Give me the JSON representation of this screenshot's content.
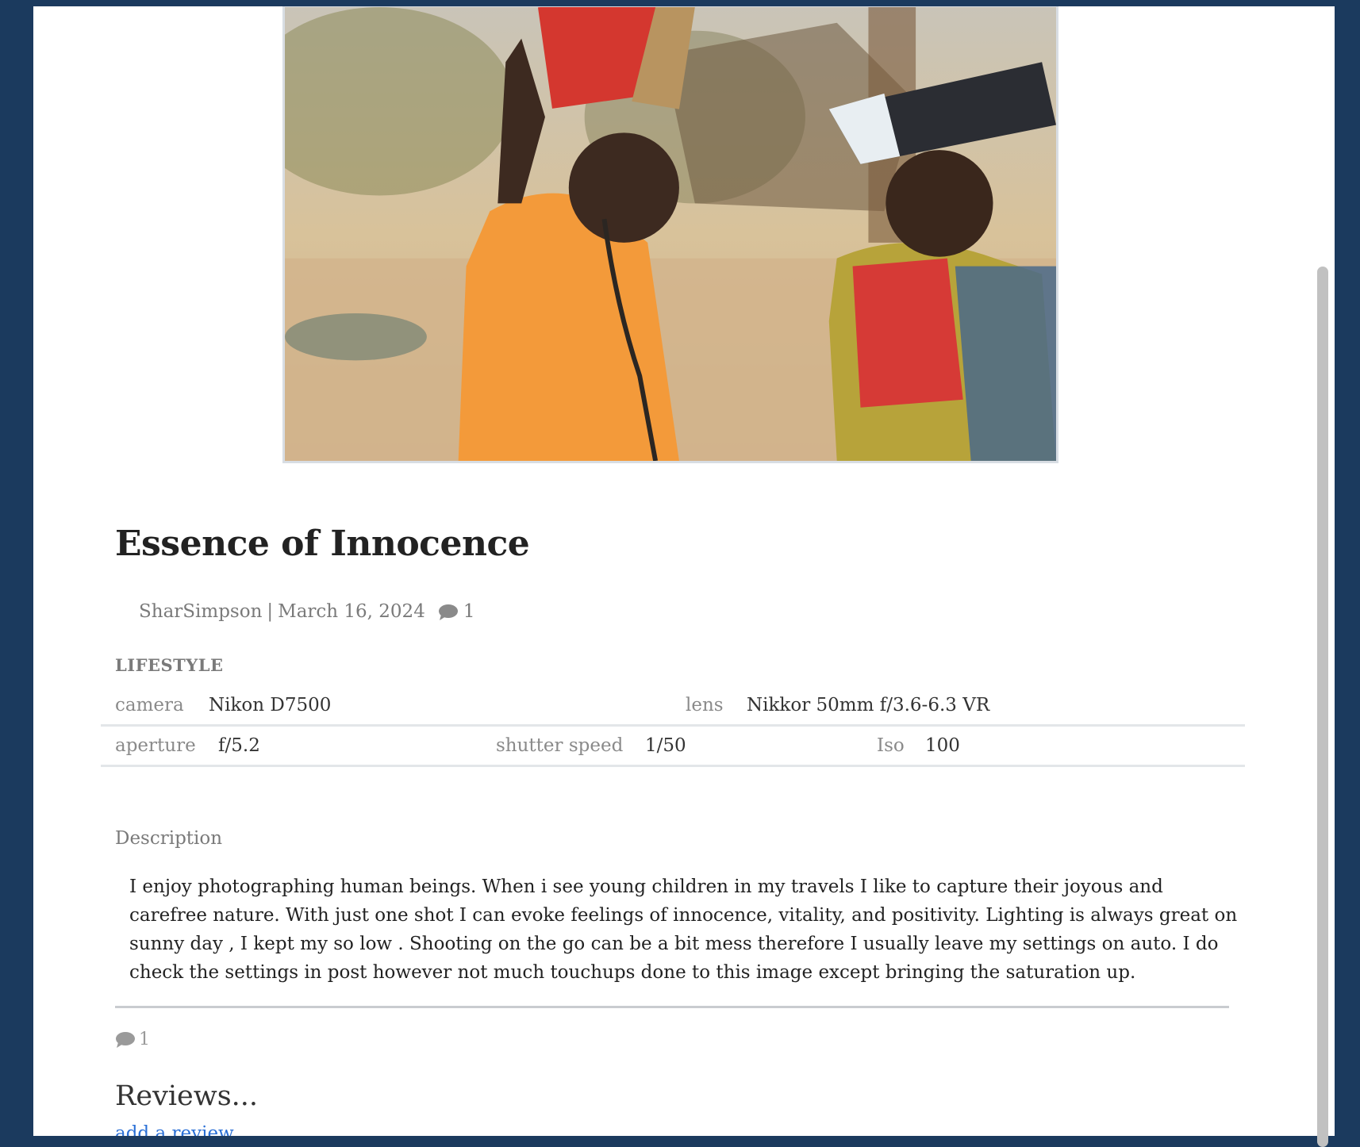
{
  "post": {
    "title": "Essence of Innocence",
    "author": "SharSimpson",
    "separator": "|",
    "date": "March 16, 2024",
    "comment_count": "1",
    "category": "LIFESTYLE"
  },
  "specs": {
    "camera_label": "camera",
    "camera_value": "Nikon D7500",
    "lens_label": "lens",
    "lens_value": "Nikkor 50mm f/3.6-6.3 VR",
    "aperture_label": "aperture",
    "aperture_value": "f/5.2",
    "shutter_label": "shutter speed",
    "shutter_value": "1/50",
    "iso_label": "Iso",
    "iso_value": "100"
  },
  "description": {
    "label": "Description",
    "text": "I enjoy photographing human beings. When i see young children in my travels I like to capture their joyous and carefree nature. With just one shot I can evoke feelings of innocence, vitality, and positivity. Lighting is always great on sunny day , I kept my so low . Shooting on the go can be a bit mess therefore I usually leave my settings on auto. I do check the settings in post however not much touchups done to this image except bringing the saturation up."
  },
  "reviews": {
    "comment_count": "1",
    "heading": "Reviews...",
    "add_link": "add a review"
  },
  "icons": {
    "comment": "comment-bubble-icon"
  },
  "colors": {
    "page_background": "#1b3a5e",
    "link": "#2a6fd6",
    "muted_text": "#7a7a7a"
  }
}
